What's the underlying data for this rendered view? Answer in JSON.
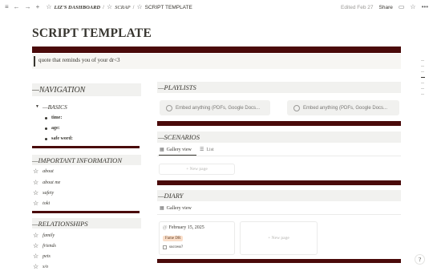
{
  "topbar": {
    "menu_icon": "≡",
    "back_icon": "←",
    "forward_icon": "→",
    "add_icon": "+",
    "star_icon": "☆",
    "crumbs": [
      {
        "label": "LIZ'S DASHBOARD"
      },
      {
        "label": "SCRAP"
      },
      {
        "label": "SCRIPT TEMPLATE"
      }
    ],
    "separator": "/",
    "edited": "Edited Feb 27",
    "share": "Share",
    "comment_icon": "▭",
    "more_icon": "•••"
  },
  "page": {
    "title": "SCRIPT TEMPLATE",
    "callout": "quote that reminds you of your dr<3"
  },
  "left": {
    "navigation": "—NAVIGATION",
    "basics_toggle": "—BASICS",
    "basics_items": [
      "time:",
      "age:",
      "safe word:"
    ],
    "important": "—IMPORTANT INFORMATION",
    "important_links": [
      "about",
      "about me",
      "safety",
      "toki"
    ],
    "relationships": "—RELATIONSHIPS",
    "relationship_links": [
      "family",
      "friends",
      "pets",
      "s/o"
    ]
  },
  "right": {
    "playlists": "—PLAYLISTS",
    "embeds": [
      "Embed anything (PDFs, Google Docs...",
      "Embed anything (PDFs, Google Docs..."
    ],
    "scenarios": "—SCENARIOS",
    "scenario_tabs": [
      "Gallery view",
      "List"
    ],
    "new_page": "+ New page",
    "diary": "—DIARY",
    "diary_tab": "Gallery view",
    "diary_card": {
      "date": "February 15, 2025",
      "tag": "Fame DR",
      "checkbox_label": "success?"
    },
    "diary_new_page": "+ New page"
  },
  "icons": {
    "gallery_icon": "▦",
    "list_icon": "☰",
    "link_star": "☆",
    "help": "?"
  },
  "colors": {
    "accent_bar": "#4a0a0a",
    "tag_bg": "#fadec9"
  }
}
